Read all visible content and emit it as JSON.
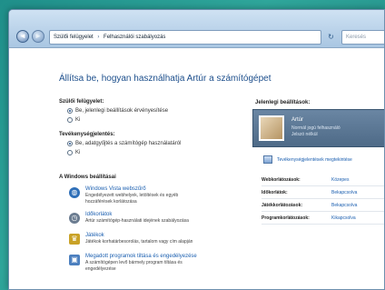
{
  "window": {
    "breadcrumb": [
      "Szülői felügyelet",
      "Felhasználói szabályozás"
    ],
    "search_placeholder": "Keresés",
    "nav_back_glyph": "◄",
    "nav_fwd_glyph": "►",
    "refresh_glyph": "↻"
  },
  "page": {
    "title": "Állítsa be, hogyan használhatja Artúr a számítógépet"
  },
  "parental_controls": {
    "label": "Szülői felügyelet:",
    "options": [
      {
        "label": "Be, jelenlegi beállítások érvényesítése",
        "selected": true
      },
      {
        "label": "Ki",
        "selected": false
      }
    ]
  },
  "activity_reporting": {
    "label": "Tevékenységjelentés:",
    "options": [
      {
        "label": "Be, adatgyűjtés a számítógép használatáról",
        "selected": true
      },
      {
        "label": "Ki",
        "selected": false
      }
    ]
  },
  "windows_settings": {
    "label": "A Windows beállításai",
    "items": [
      {
        "title": "Windows Vista webszűrő",
        "subtitle": "Engedélyezett webhelyek, letöltések és egyéb",
        "subtitle2": "hozzáférések korlátozása",
        "icon": "globe-icon",
        "color": "#2f6fb8"
      },
      {
        "title": "Időkorlátok",
        "subtitle": "Artúr számítógép-használati idejének szabályozása",
        "subtitle2": "",
        "icon": "clock-icon",
        "color": "#6b7c90"
      },
      {
        "title": "Játékok",
        "subtitle": "Játékok korhatárbesorolás, tartalom vagy cím alapján",
        "subtitle2": "",
        "icon": "trophy-icon",
        "color": "#c9a227"
      },
      {
        "title": "Megadott programok tiltása és engedélyezése",
        "subtitle": "A számítógépen levő bármely program tiltása és",
        "subtitle2": "engedélyezése",
        "icon": "program-icon",
        "color": "#4b7fbf"
      }
    ]
  },
  "current_settings": {
    "heading": "Jelenlegi beállítások:",
    "user_name": "Artúr",
    "user_sub": "Normál jogú felhasználó",
    "user_sub2": "Jelszó nélkül",
    "activity_link": "Tevékenységjelentések megtekintése",
    "rows": [
      {
        "key": "Webkorlátozások:",
        "value": "Közepes"
      },
      {
        "key": "Időkorlátok:",
        "value": "Bekapcsolva"
      },
      {
        "key": "Játékkorlátozások:",
        "value": "Bekapcsolva"
      },
      {
        "key": "Programkorlátozások:",
        "value": "Kikapcsolva"
      }
    ]
  }
}
